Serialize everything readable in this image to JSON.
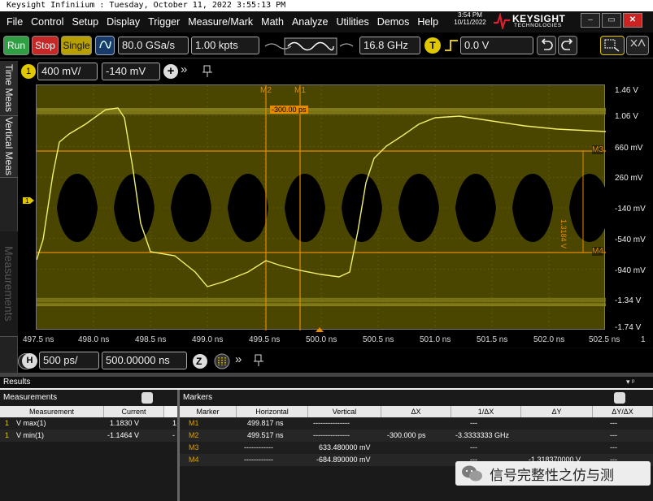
{
  "title": "Keysight Infiniium : Tuesday, October 11, 2022 3:55:13 PM",
  "menu": [
    "File",
    "Control",
    "Setup",
    "Display",
    "Trigger",
    "Measure/Mark",
    "Math",
    "Analyze",
    "Utilities",
    "Demos",
    "Help"
  ],
  "clock": {
    "time": "3:54 PM",
    "date": "10/11/2022"
  },
  "brand": {
    "name": "KEYSIGHT",
    "sub": "TECHNOLOGIES"
  },
  "toolbar": {
    "run": "Run",
    "stop": "Stop",
    "single": "Single",
    "sample_rate": "80.0 GSa/s",
    "memory": "1.00 kpts",
    "bandwidth": "16.8 GHz",
    "trigger_icon": "T",
    "trigger_level": "0.0 V"
  },
  "channel": {
    "number": "1",
    "scale": "400 mV/",
    "offset": "-140 mV"
  },
  "tabs": {
    "time": "Time Meas",
    "vertical": "Vertical Meas",
    "measurements": "Measurements"
  },
  "markers_top": {
    "m2": "M2",
    "m1": "M1",
    "delta": "-300.00 ps"
  },
  "markers_side": {
    "m3": "M3",
    "m4": "M4",
    "dy": "1.3184 V"
  },
  "y_labels": [
    "1.46 V",
    "1.06 V",
    "660 mV",
    "260 mV",
    "-140 mV",
    "-540 mV",
    "-940 mV",
    "-1.34 V",
    "-1.74 V"
  ],
  "x_labels": [
    "497.5 ns",
    "498.0 ns",
    "498.5 ns",
    "499.0 ns",
    "499.5 ns",
    "500.0 ns",
    "500.5 ns",
    "501.0 ns",
    "501.5 ns",
    "502.0 ns",
    "502.5 ns"
  ],
  "x_tail": "1",
  "timebase": {
    "icon": "H",
    "scale": "500 ps/",
    "position": "500.00000 ns"
  },
  "results": {
    "title": "Results",
    "meas_title": "Measurements",
    "meas_headers": [
      "Measurement",
      "Current"
    ],
    "meas_rows": [
      {
        "bullet": "1",
        "name": "V max(1)",
        "value": "1.1830 V",
        "extra": "1"
      },
      {
        "bullet": "1",
        "name": "V min(1)",
        "value": "-1.1464 V",
        "extra": "-"
      }
    ],
    "markers_title": "Markers",
    "marker_headers": [
      "Marker",
      "Horizontal",
      "Vertical",
      "ΔX",
      "1/ΔX",
      "ΔY",
      "ΔY/ΔX"
    ],
    "marker_rows": [
      {
        "m": "M1",
        "h": "499.817 ns",
        "v": "---------------",
        "dx": "",
        "idx": "---",
        "dy": "",
        "dydx": "---"
      },
      {
        "m": "M2",
        "h": "499.517 ns",
        "v": "---------------",
        "dx": "-300.000 ps",
        "idx": "-3.3333333 GHz",
        "dy": "",
        "dydx": "---"
      },
      {
        "m": "M3",
        "h": "------------",
        "v": "633.480000 mV",
        "dx": "",
        "idx": "---",
        "dy": "",
        "dydx": "---"
      },
      {
        "m": "M4",
        "h": "------------",
        "v": "-684.890000 mV",
        "dx": "",
        "idx": "---",
        "dy": "-1.318370000 V",
        "dydx": "---"
      }
    ]
  },
  "watermark": "信号完整性之仿与测",
  "colors": {
    "trace": "#f2f06a",
    "grid_bg": "#4a4600",
    "marker": "#e68a00",
    "run": "#2ea043",
    "stop": "#c62828",
    "single": "#b8a000"
  }
}
